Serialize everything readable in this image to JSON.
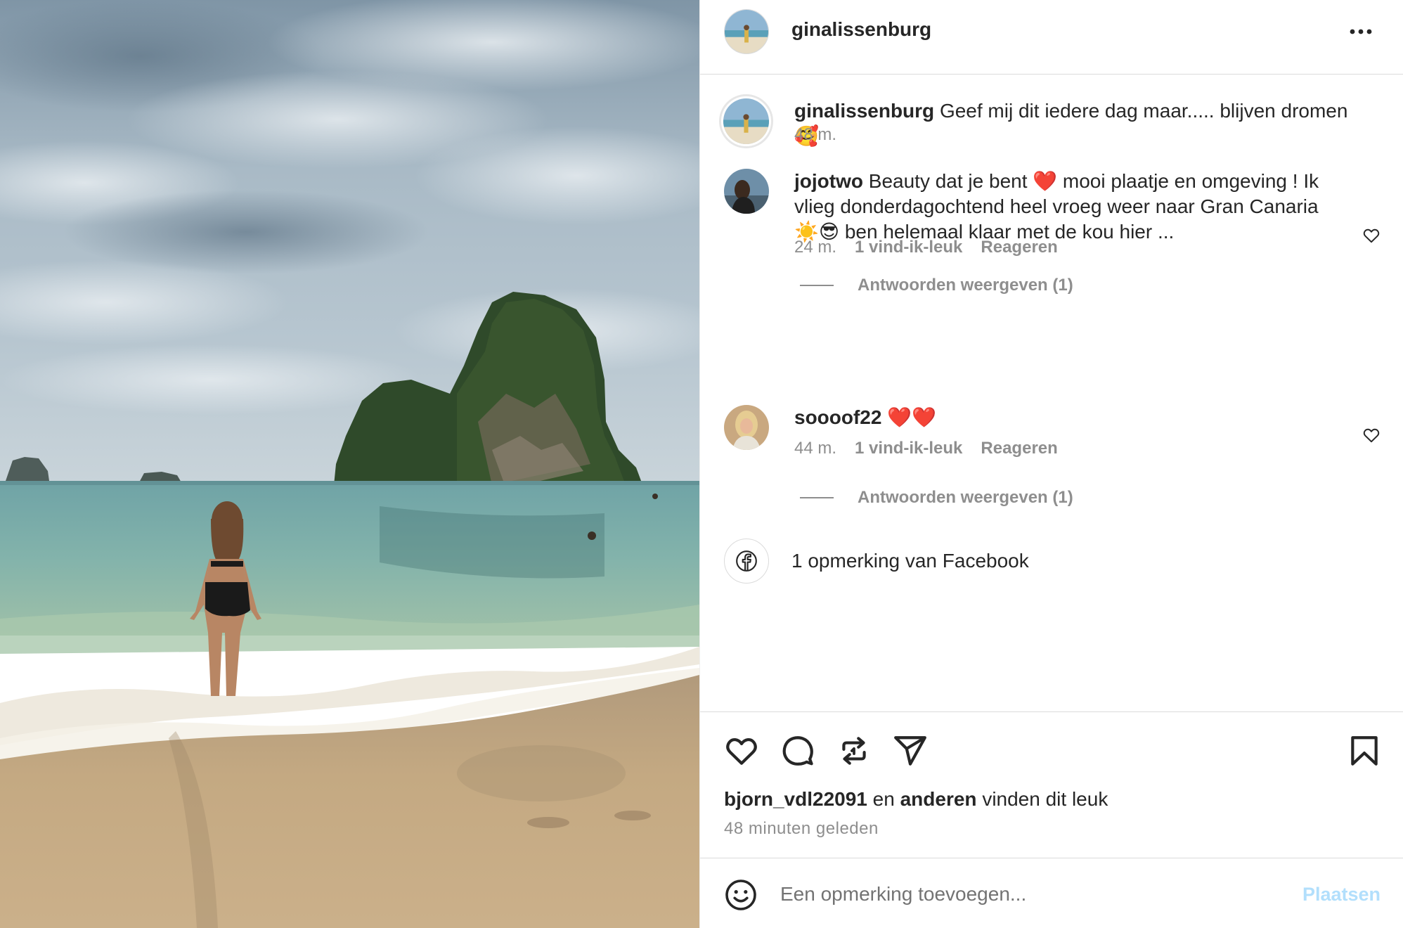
{
  "post": {
    "username": "ginalissenburg",
    "more_icon": "more-horizontal-icon",
    "photo_alt": "beach-photo"
  },
  "caption": {
    "username": "ginalissenburg",
    "text_line1": "Geef mij dit iedere dag maar..... blijven dromen",
    "text_line2": "🥰",
    "time": "48 m."
  },
  "comments": [
    {
      "username": "jojotwo",
      "text_line1": "Beauty dat je bent ❤️ mooi plaatje en omgeving ! Ik",
      "text_line2": "vlieg donderdagochtend heel vroeg weer naar Gran Canaria",
      "text_line3": "☀️😎 ben helemaal klaar met de kou hier ...",
      "time": "24 m.",
      "likes": "1 vind-ik-leuk",
      "reply": "Reageren",
      "view_replies": "Antwoorden weergeven (1)"
    },
    {
      "username": "soooof22",
      "text_line1": "❤️❤️",
      "time": "44 m.",
      "likes": "1 vind-ik-leuk",
      "reply": "Reageren",
      "view_replies": "Antwoorden weergeven (1)"
    }
  ],
  "facebook": {
    "text": "1 opmerking van Facebook",
    "icon": "facebook-icon"
  },
  "actions": {
    "icons": [
      "heart-icon",
      "comment-icon",
      "repost-icon",
      "share-icon",
      "bookmark-icon"
    ]
  },
  "likes_line": {
    "user": "bjorn_vdl22091",
    "connector": "en",
    "others": "anderen",
    "suffix": "vinden dit leuk"
  },
  "time_ago": "48 minuten geleden",
  "add_comment": {
    "placeholder": "Een opmerking toevoegen...",
    "post_label": "Plaatsen",
    "emoji_icon": "smiley-icon"
  },
  "colors": {
    "text": "#262626",
    "muted": "#8e8e8e",
    "border": "#dbdbdb",
    "post_button_disabled": "#b2dffc"
  }
}
